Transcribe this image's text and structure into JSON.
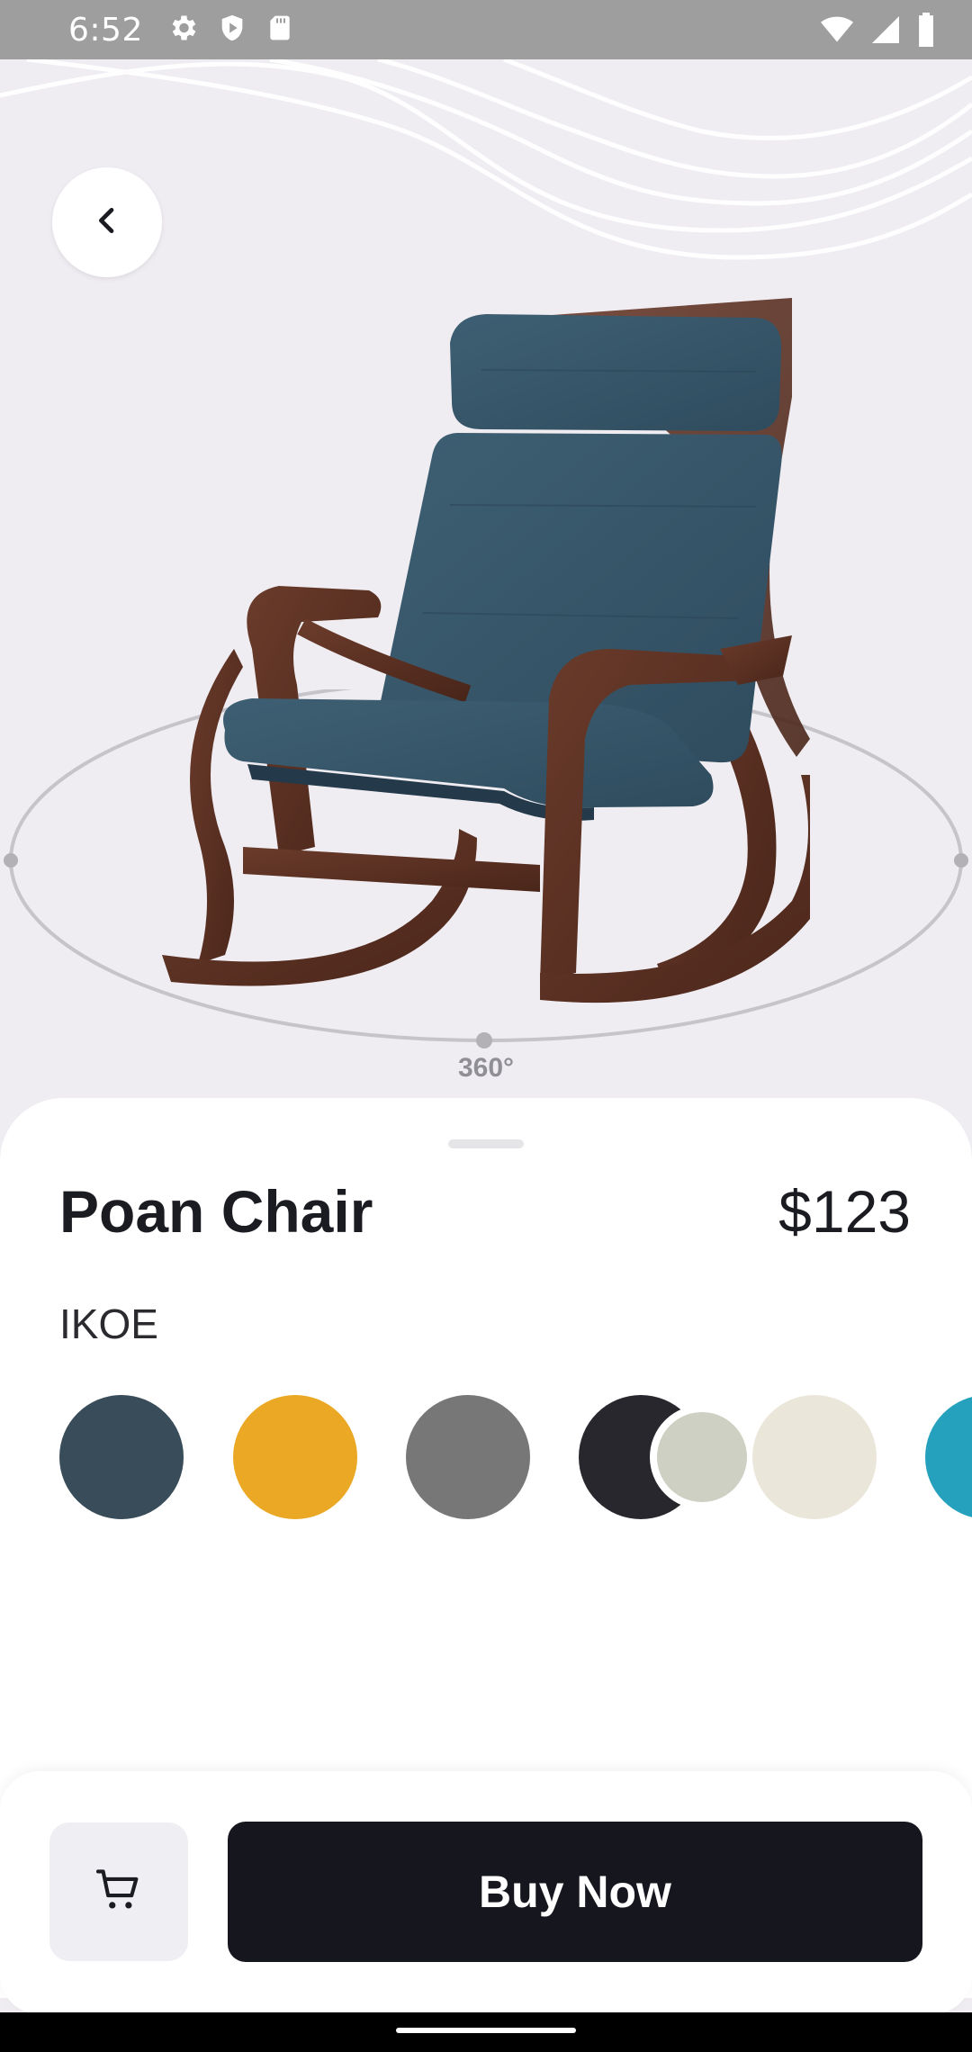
{
  "status_bar": {
    "time": "6:52",
    "left_icons": [
      "gear-icon",
      "shield-icon",
      "sd-card-icon"
    ],
    "right_icons": [
      "wifi-icon",
      "signal-icon",
      "battery-icon"
    ]
  },
  "header": {
    "back_icon": "chevron-left-icon"
  },
  "viewer": {
    "rotation_label": "360°"
  },
  "product": {
    "name": "Poan Chair",
    "price": "$123",
    "brand": "IKOE"
  },
  "swatches": [
    {
      "name": "slate-blue",
      "color": "#384c5a"
    },
    {
      "name": "mustard",
      "color": "#eaa824"
    },
    {
      "name": "grey",
      "color": "#777777"
    },
    {
      "name": "charcoal",
      "color": "#28272e"
    },
    {
      "name": "sage",
      "color": "#cfd0c4"
    },
    {
      "name": "cream",
      "color": "#eae6da"
    },
    {
      "name": "teal",
      "color": "#25a1bd"
    }
  ],
  "actions": {
    "buy_label": "Buy Now",
    "cart_icon": "cart-icon"
  },
  "colors": {
    "background": "#efedf2",
    "primary_button": "#16161f",
    "chair_fabric": "#36566a",
    "chair_frame": "#5a3022"
  }
}
